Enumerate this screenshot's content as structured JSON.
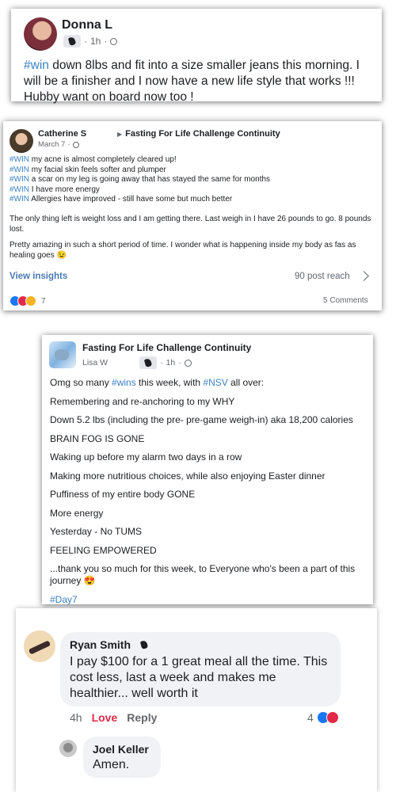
{
  "post1": {
    "author": "Donna L",
    "time": "1h",
    "hashtag": "#win",
    "text": " down 8lbs and fit into a size smaller jeans this morning. I will be a finisher and I now have a new life style that works !!! Hubby want on board now too !"
  },
  "post2": {
    "author": "Catherine S",
    "group": "Fasting For Life Challenge Continuity",
    "date": "March 7",
    "wins": [
      {
        "tag": "#WIN",
        "text": " my acne is almost completely cleared up!"
      },
      {
        "tag": "#WIN",
        "text": " my facial skin feels softer and plumper"
      },
      {
        "tag": "#WIN",
        "text": " a scar on my leg is going away that has stayed the same for months"
      },
      {
        "tag": "#WIN",
        "text": " I have more energy"
      },
      {
        "tag": "#WIN",
        "text": " Allergies have improved - still have some but much better"
      }
    ],
    "para1": "The only thing left is weight loss and I am getting there.  Last weigh in I have 26 pounds to go. 8 pounds lost.",
    "para2": "Pretty amazing in such a short period of time.  I wonder what is happening inside my body as fas as healing goes 😉",
    "insights_label": "View insights",
    "reach": "90 post reach",
    "reaction_count": "7",
    "comments": "5 Comments"
  },
  "post3": {
    "group": "Fasting For Life Challenge Continuity",
    "author": "Lisa W",
    "time": "1h",
    "intro_a": "Omg so many ",
    "intro_tag1": "#wins",
    "intro_b": " this week, with ",
    "intro_tag2": "#NSV",
    "intro_c": " all over:",
    "lines": [
      "Remembering and re-anchoring to my WHY",
      "Down 5.2 lbs (including the pre- pre-game weigh-in) aka 18,200 calories",
      "BRAIN FOG IS GONE",
      "Waking up before my alarm two days in a row",
      "Making more nutritious choices, while also enjoying Easter dinner",
      "Puffiness of my entire body GONE",
      "More energy",
      "Yesterday - No TUMS",
      "FEELING EMPOWERED",
      "...thank you so much for this week, to Everyone who's been a part of this journey 😍"
    ],
    "hashtag": "#Day7"
  },
  "comment1": {
    "author": "Ryan Smith",
    "text": "I pay $100 for a 1 great meal all the time. This cost less, last a week and makes me healthier... well worth it",
    "time": "4h",
    "love_label": "Love",
    "reply_label": "Reply",
    "reaction_count": "4"
  },
  "comment2": {
    "author": "Joel Keller",
    "text": "Amen."
  }
}
